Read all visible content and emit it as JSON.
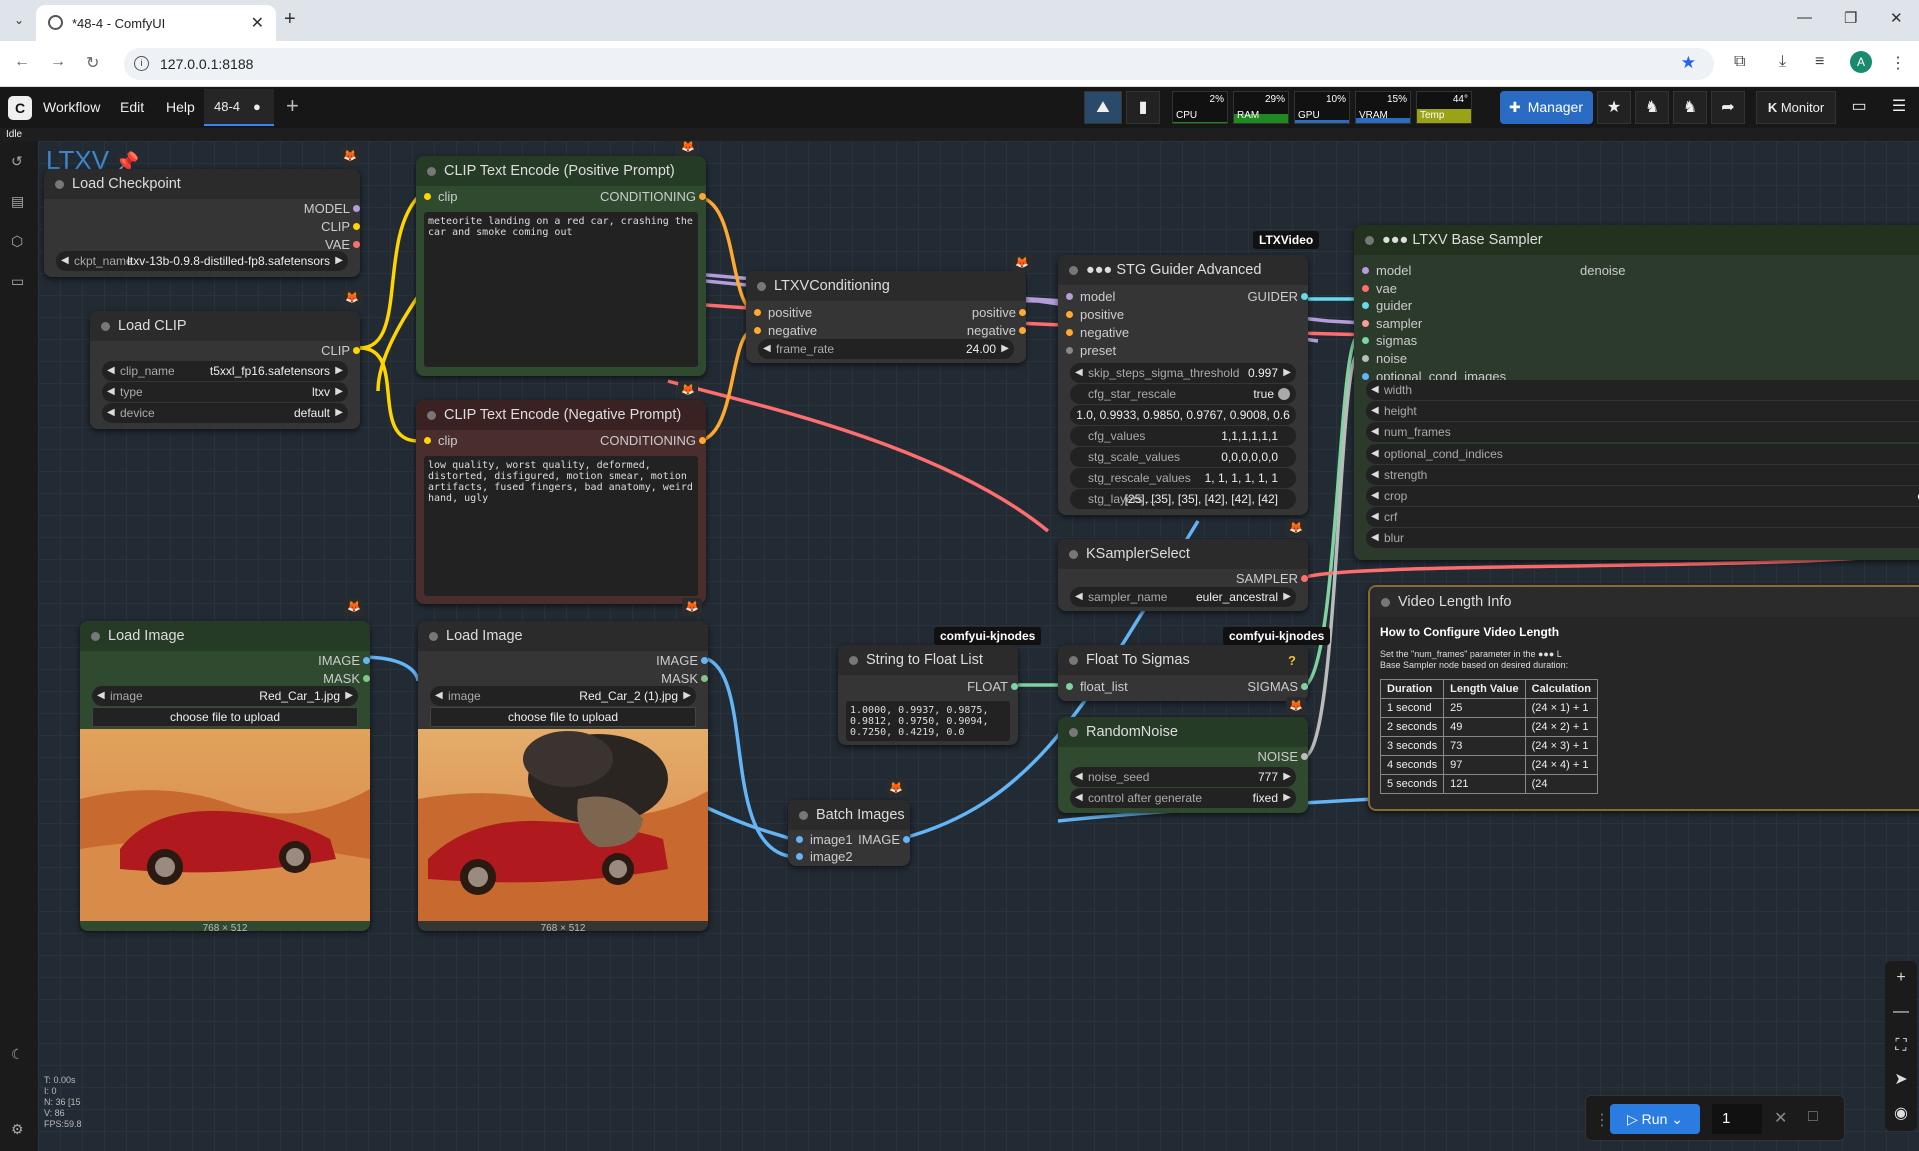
{
  "browser": {
    "tab_title": "*48-4 - ComfyUI",
    "url": "127.0.0.1:8188",
    "profile_initial": "A"
  },
  "menu": {
    "items": [
      "Workflow",
      "Edit",
      "Help"
    ],
    "workflow_tab": "48-4",
    "status": "Idle",
    "manager": "Manager",
    "monitor": "Monitor"
  },
  "monitors": [
    {
      "label": "CPU",
      "pct": "2%",
      "value": 0.02,
      "color": "#1f8a1f"
    },
    {
      "label": "RAM",
      "pct": "29%",
      "value": 0.29,
      "color": "#1f8a1f"
    },
    {
      "label": "GPU",
      "pct": "10%",
      "value": 0.1,
      "color": "#2a6cc4"
    },
    {
      "label": "VRAM",
      "pct": "15%",
      "value": 0.15,
      "color": "#2a6cc4"
    },
    {
      "label": "Temp",
      "pct": "44°",
      "value": 0.44,
      "color": "#9aa316"
    }
  ],
  "group": {
    "title": "LTXV"
  },
  "nodes": {
    "load_checkpoint": {
      "title": "Load Checkpoint",
      "outputs": [
        "MODEL",
        "CLIP",
        "VAE"
      ],
      "ckpt_name_key": "ckpt_name",
      "ckpt_name": "ltxv-13b-0.9.8-distilled-fp8.safetensors"
    },
    "load_clip": {
      "title": "Load CLIP",
      "output": "CLIP",
      "widgets": [
        {
          "k": "clip_name",
          "v": "t5xxl_fp16.safetensors"
        },
        {
          "k": "type",
          "v": "ltxv"
        },
        {
          "k": "device",
          "v": "default"
        }
      ]
    },
    "clip_pos": {
      "title": "CLIP Text Encode (Positive Prompt)",
      "input": "clip",
      "output": "CONDITIONING",
      "text": "meteorite landing on a red car, crashing the car and smoke coming out"
    },
    "clip_neg": {
      "title": "CLIP Text Encode (Negative Prompt)",
      "input": "clip",
      "output": "CONDITIONING",
      "text": "low quality, worst quality, deformed, distorted, disfigured, motion smear, motion artifacts, fused fingers, bad anatomy, weird hand, ugly"
    },
    "ltxv_cond": {
      "title": "LTXVConditioning",
      "inputs": [
        "positive",
        "negative"
      ],
      "outputs": [
        "positive",
        "negative"
      ],
      "frame_rate_key": "frame_rate",
      "frame_rate": "24.00"
    },
    "stg": {
      "title": "STG Guider Advanced",
      "inputs": [
        "model",
        "positive",
        "negative",
        "preset"
      ],
      "output": "GUIDER",
      "widgets": [
        {
          "k": "skip_steps_sigma_threshold",
          "v": "0.997"
        },
        {
          "k": "cfg_star_rescale",
          "v": "true"
        },
        {
          "k": "",
          "v": "1.0, 0.9933, 0.9850, 0.9767, 0.9008, 0.6 ..."
        },
        {
          "k": "cfg_values",
          "v": "1,1,1,1,1,1"
        },
        {
          "k": "stg_scale_values",
          "v": "0,0,0,0,0,0"
        },
        {
          "k": "stg_rescale_values",
          "v": "1, 1, 1, 1, 1, 1"
        },
        {
          "k": "stg_layers ...",
          "v": "[25], [35], [35], [42], [42], [42]"
        }
      ]
    },
    "base_sampler": {
      "title": "LTXV Base Sampler",
      "inputs": [
        "model",
        "vae",
        "guider",
        "sampler",
        "sigmas",
        "noise",
        "optional_cond_images"
      ],
      "right_label": "denoise",
      "widgets": [
        "width",
        "height",
        "num_frames",
        "optional_cond_indices",
        "strength",
        "crop",
        "crf",
        "blur"
      ],
      "crop_value": "ce"
    },
    "ksampler_select": {
      "title": "KSamplerSelect",
      "output": "SAMPLER",
      "sampler_name_key": "sampler_name",
      "sampler_name": "euler_ancestral"
    },
    "string_float": {
      "title": "String to Float List",
      "output": "FLOAT",
      "text": "1.0000, 0.9937, 0.9875, 0.9812, 0.9750, 0.9094, 0.7250, 0.4219, 0.0",
      "badge": "comfyui-kjnodes"
    },
    "float_sigmas": {
      "title": "Float To Sigmas",
      "input": "float_list",
      "output": "SIGMAS",
      "badge": "comfyui-kjnodes",
      "help": "?"
    },
    "random_noise": {
      "title": "RandomNoise",
      "output": "NOISE",
      "widgets": [
        {
          "k": "noise_seed",
          "v": "777"
        },
        {
          "k": "control after generate",
          "v": "fixed"
        }
      ]
    },
    "load_image1": {
      "title": "Load Image",
      "outputs": [
        "IMAGE",
        "MASK"
      ],
      "image_key": "image",
      "image": "Red_Car_1.jpg",
      "upload": "choose file to upload",
      "size": "768 × 512"
    },
    "load_image2": {
      "title": "Load Image",
      "outputs": [
        "IMAGE",
        "MASK"
      ],
      "image_key": "image",
      "image": "Red_Car_2 (1).jpg",
      "upload": "choose file to upload",
      "size": "768 × 512"
    },
    "batch": {
      "title": "Batch Images",
      "inputs": [
        "image1",
        "image2"
      ],
      "output": "IMAGE"
    },
    "video_info": {
      "title": "Video Length Info",
      "heading": "How to Configure Video Length",
      "desc1": "Set the \"num_frames\" parameter in the ●●● L",
      "desc2": "Base Sampler node based on desired duration:",
      "cols": [
        "Duration",
        "Length Value",
        "Calculation"
      ],
      "rows": [
        [
          "1 second",
          "25",
          "(24 × 1) + 1"
        ],
        [
          "2 seconds",
          "49",
          "(24 × 2) + 1"
        ],
        [
          "3 seconds",
          "73",
          "(24 × 3) + 1"
        ],
        [
          "4 seconds",
          "97",
          "(24 × 4) + 1"
        ],
        [
          "5 seconds",
          "121",
          "(24"
        ]
      ]
    }
  },
  "ltxvideo_badge": "LTXVideo",
  "run": {
    "label": "Run",
    "count": "1"
  },
  "stats": [
    "T: 0.00s",
    "I: 0",
    "N: 36 [15",
    "V: 86",
    "FPS:59.8"
  ],
  "colors": {
    "model": "#b39ddb",
    "clip": "#ffd500",
    "vae": "#ff6e6e",
    "cond": "#ffa931",
    "image": "#64b5f6",
    "mask": "#81c784",
    "sigmas": "#7fd3a0",
    "guider": "#66d9ef"
  }
}
